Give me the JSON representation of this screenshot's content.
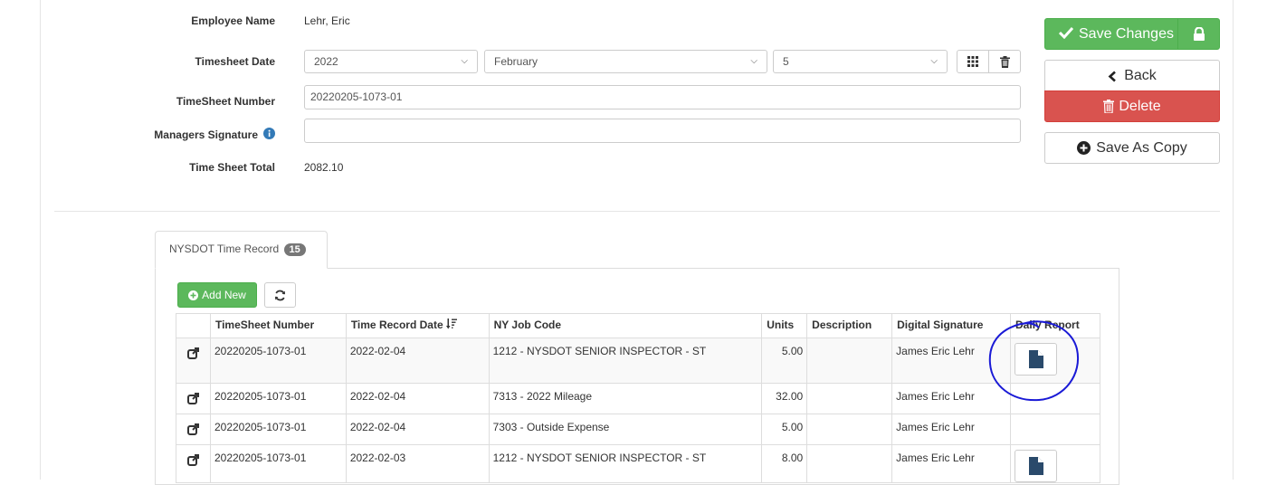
{
  "form": {
    "employee_name_label": "Employee Name",
    "employee_name": "Lehr, Eric",
    "timesheet_date_label": "Timesheet Date",
    "year": "2022",
    "month": "February",
    "day": "5",
    "timesheet_number_label": "TimeSheet Number",
    "timesheet_number": "20220205-1073-01",
    "managers_signature_label": "Managers Signature",
    "managers_signature": "",
    "total_label": "Time Sheet Total",
    "total": "2082.10"
  },
  "actions": {
    "save": "Save Changes",
    "back": "Back",
    "delete": "Delete",
    "save_copy": "Save As Copy"
  },
  "tab": {
    "label": "NYSDOT Time Record",
    "count": "15"
  },
  "toolbar": {
    "add_new": "Add New"
  },
  "table": {
    "headers": [
      "TimeSheet Number",
      "Time Record Date",
      "NY Job Code",
      "Units",
      "Description",
      "Digital Signature",
      "Daily Report"
    ],
    "rows": [
      {
        "ts": "20220205-1073-01",
        "date": "2022-02-04",
        "job": "1212 - NYSDOT SENIOR INSPECTOR - ST",
        "units": "5.00",
        "desc": "",
        "sig": "James Eric Lehr",
        "report": true
      },
      {
        "ts": "20220205-1073-01",
        "date": "2022-02-04",
        "job": "7313 - 2022 Mileage",
        "units": "32.00",
        "desc": "",
        "sig": "James Eric Lehr",
        "report": false
      },
      {
        "ts": "20220205-1073-01",
        "date": "2022-02-04",
        "job": "7303 - Outside Expense",
        "units": "5.00",
        "desc": "",
        "sig": "James Eric Lehr",
        "report": false
      },
      {
        "ts": "20220205-1073-01",
        "date": "2022-02-03",
        "job": "1212 - NYSDOT SENIOR INSPECTOR - ST",
        "units": "8.00",
        "desc": "",
        "sig": "James Eric Lehr",
        "report": true
      }
    ]
  },
  "icons": {
    "save": "check-icon",
    "lock": "lock-icon",
    "back": "chevron-left-icon",
    "delete": "trash-icon",
    "copy": "plus-circle-icon",
    "info": "info-icon",
    "calendar": "grid-icon",
    "clear": "trash-icon",
    "refresh": "refresh-icon",
    "edit": "external-link-icon",
    "report": "file-icon",
    "sort": "sort-desc-icon"
  },
  "colors": {
    "success": "#5cb85c",
    "danger": "#d9534f",
    "info": "#337ab7",
    "annotation": "#1a1ad6"
  }
}
